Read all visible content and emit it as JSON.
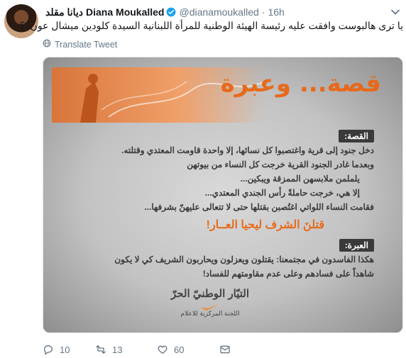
{
  "tweet": {
    "arabic_name": "ديانا مقلد",
    "name": "Diana Moukalled",
    "handle": "@dianamoukalled",
    "separator": "·",
    "time": "16h",
    "text": "يا ترى هالبوست وافقت عليه رئيسة الهيئة الوطنية للمرأة اللبنانية السيدة كلودين ميشال عون؟؟",
    "translate_label": "Translate Tweet"
  },
  "poster": {
    "title": "قصة... وعبرة",
    "story_label": "القصة:",
    "story_lines": [
      "دخل جنود إلى قرية واغتصبوا كل نسائها، إلا واحدة قاومت المعتدي وقتلته.",
      "وبعدما غادر الجنود القرية خرجت كل النساء من بيوتهن",
      "يلملمن ملابسهن الممزقة ويبكين...",
      "إلا هي، خرجت حاملةً رأس الجندي المعتدي...",
      "فقامت النساء اللواتي اغتُصبن بقتلها حتى لا تتعالى عليهنّ بشرفها..."
    ],
    "slogan": "قتلنَ الشرف ليحيا العــار!",
    "lesson_label": "العبرة:",
    "lesson_lines": [
      "هكذا الفاسدون في مجتمعنا: يقتلون ويعزلون ويحاربون الشريف كي لا يكون",
      "شاهداً على فسادهم وعلى عدم مقاومتهم للفساد!"
    ],
    "party_name": "التيّار الوطنيّ الحرّ",
    "party_sub": "اللجنة المركزية للاعلام",
    "accent_color": "#e76a1c"
  },
  "actions": {
    "replies": "10",
    "retweets": "13",
    "likes": "60"
  },
  "colors": {
    "text": "#14171a",
    "secondary": "#657786",
    "verified": "#1da1f2"
  }
}
